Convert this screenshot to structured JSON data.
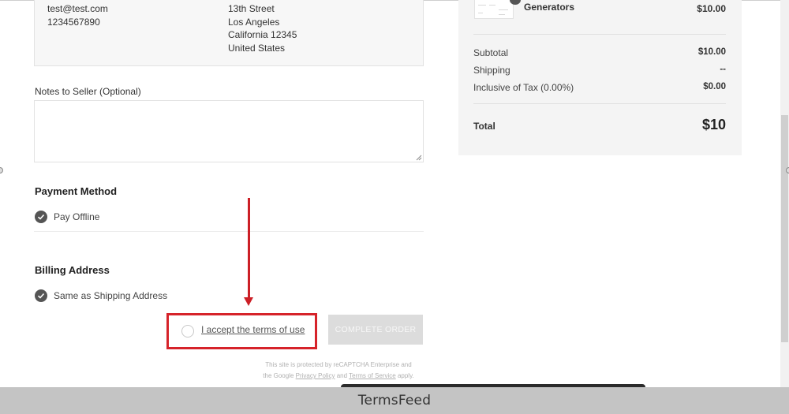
{
  "shipping_address": {
    "contact": [
      "test@test.com",
      "1234567890"
    ],
    "address": [
      "13th Street",
      "Los Angeles",
      "California 12345",
      "United States"
    ]
  },
  "notes": {
    "label": "Notes to Seller (Optional)",
    "value": ""
  },
  "payment_method": {
    "title": "Payment Method",
    "option": "Pay Offline"
  },
  "billing_address": {
    "title": "Billing Address",
    "option": "Same as Shipping Address"
  },
  "terms": {
    "label": "I accept the terms of use"
  },
  "actions": {
    "complete_order": "COMPLETE ORDER"
  },
  "recaptcha": {
    "line1": "This site is protected by reCAPTCHA Enterprise and",
    "prefix": "the Google",
    "privacy": "Privacy Policy",
    "and": "and",
    "terms": "Terms of Service",
    "suffix": "apply."
  },
  "summary": {
    "product_name": "Generators",
    "product_price": "$10.00",
    "rows": [
      {
        "label": "Subtotal",
        "value": "$10.00"
      },
      {
        "label": "Shipping",
        "value": "--"
      },
      {
        "label": "Inclusive of Tax (0.00%)",
        "value": "$0.00"
      }
    ],
    "total_label": "Total",
    "total_value": "$10"
  },
  "footer": {
    "brand": "TermsFeed"
  },
  "colors": {
    "highlight": "#d6232a",
    "arrow": "#cc1f26",
    "check": "#555555",
    "button_disabled": "#dcdcdc"
  }
}
